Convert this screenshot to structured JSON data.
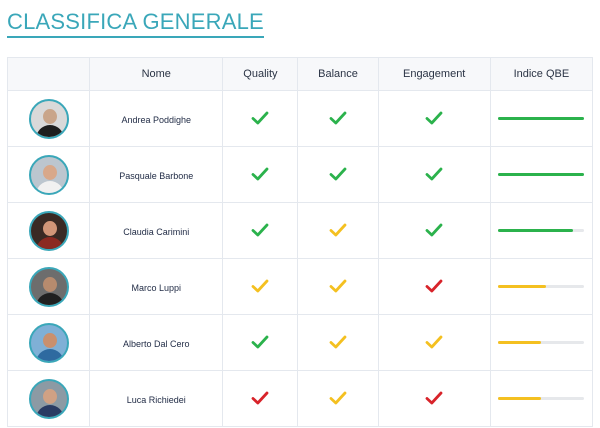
{
  "page": {
    "title": "CLASSIFICA GENERALE"
  },
  "colors": {
    "accent": "#3aa7b9",
    "ok": "#2bb24c",
    "warn": "#f4c020",
    "bad": "#d8232a"
  },
  "table": {
    "headers": [
      "Nome",
      "Quality",
      "Balance",
      "Engagement",
      "Indice QBE"
    ],
    "rows": [
      {
        "name": "Andrea Poddighe",
        "quality": "ok",
        "balance": "ok",
        "engagement": "ok",
        "qbe": 1.0,
        "qbe_color": "ok",
        "avatar": {
          "bg": "#d9d9d9",
          "skin": "#c9a58a",
          "shirt": "#1e1e1e"
        }
      },
      {
        "name": "Pasquale Barbone",
        "quality": "ok",
        "balance": "ok",
        "engagement": "ok",
        "qbe": 1.0,
        "qbe_color": "ok",
        "avatar": {
          "bg": "#bcc6cf",
          "skin": "#d8a88a",
          "shirt": "#f1f1f1"
        }
      },
      {
        "name": "Claudia Carimini",
        "quality": "ok",
        "balance": "warn",
        "engagement": "ok",
        "qbe": 0.87,
        "qbe_color": "ok",
        "avatar": {
          "bg": "#3a2a24",
          "skin": "#d29678",
          "shirt": "#8b2a22"
        }
      },
      {
        "name": "Marco Luppi",
        "quality": "warn",
        "balance": "warn",
        "engagement": "bad",
        "qbe": 0.55,
        "qbe_color": "warn",
        "avatar": {
          "bg": "#6d6d6d",
          "skin": "#b78b6e",
          "shirt": "#202020"
        }
      },
      {
        "name": "Alberto Dal Cero",
        "quality": "ok",
        "balance": "warn",
        "engagement": "warn",
        "qbe": 0.5,
        "qbe_color": "warn",
        "avatar": {
          "bg": "#7fb0d6",
          "skin": "#c9906e",
          "shirt": "#2e6aa0"
        }
      },
      {
        "name": "Luca Richiedei",
        "quality": "bad",
        "balance": "warn",
        "engagement": "bad",
        "qbe": 0.5,
        "qbe_color": "warn",
        "avatar": {
          "bg": "#8c9aa4",
          "skin": "#d0a184",
          "shirt": "#2a3b63"
        }
      }
    ]
  }
}
